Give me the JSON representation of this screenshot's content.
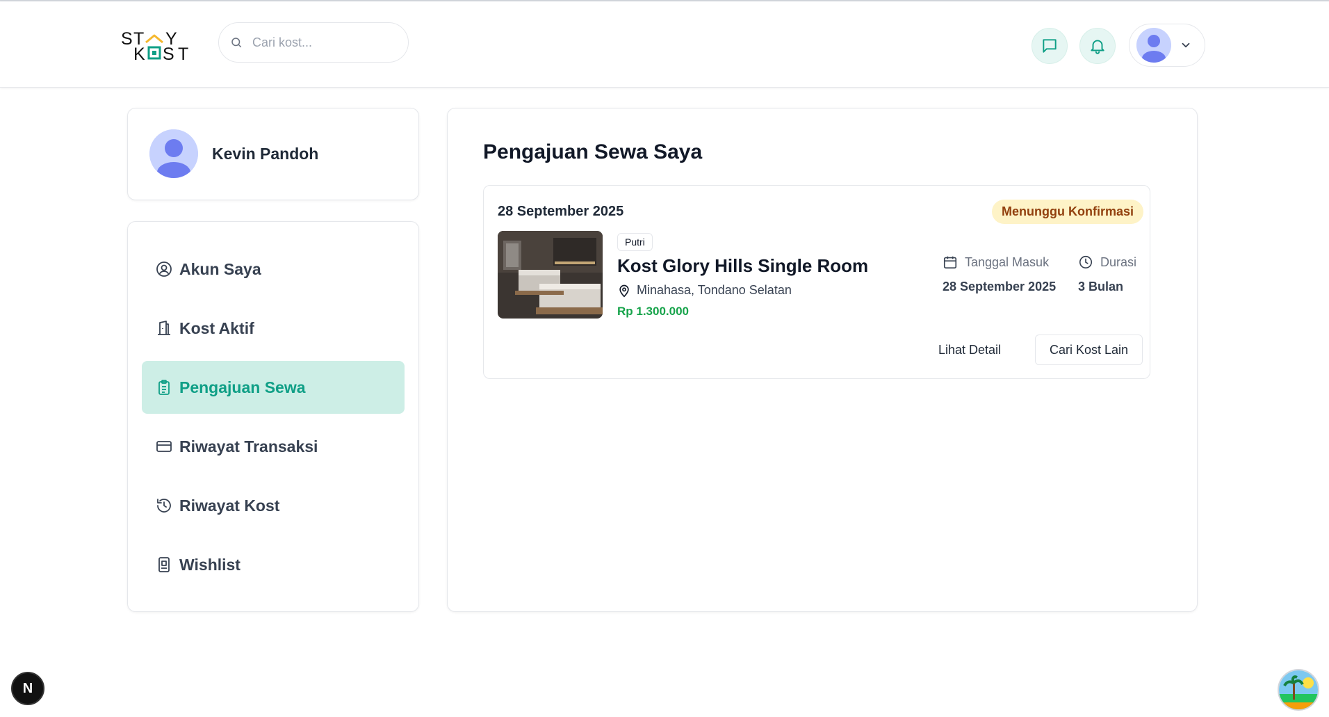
{
  "header": {
    "logo_text": "STAY KOST",
    "search": {
      "placeholder": "Cari kost...",
      "value": ""
    }
  },
  "profile": {
    "name": "Kevin Pandoh"
  },
  "sidebar": {
    "items": [
      {
        "label": "Akun Saya",
        "icon": "user-circle-icon",
        "active": false
      },
      {
        "label": "Kost Aktif",
        "icon": "building-icon",
        "active": false
      },
      {
        "label": "Pengajuan Sewa",
        "icon": "clipboard-list-icon",
        "active": true
      },
      {
        "label": "Riwayat Transaksi",
        "icon": "credit-card-icon",
        "active": false
      },
      {
        "label": "Riwayat Kost",
        "icon": "history-icon",
        "active": false
      },
      {
        "label": "Wishlist",
        "icon": "bookmark-icon",
        "active": false
      }
    ]
  },
  "main": {
    "title": "Pengajuan Sewa Saya",
    "rental": {
      "date": "28 September 2025",
      "status": "Menunggu Konfirmasi",
      "type": "Putri",
      "name": "Kost Glory Hills Single Room",
      "location": "Minahasa, Tondano Selatan",
      "price": "Rp 1.300.000",
      "check_in_label": "Tanggal Masuk",
      "check_in_value": "28 September 2025",
      "duration_label": "Durasi",
      "duration_value": "3 Bulan",
      "detail_button": "Lihat Detail",
      "search_other_button": "Cari Kost Lain"
    }
  },
  "floating": {
    "next_badge": "N"
  },
  "colors": {
    "accent": "#0f9f86",
    "accent_bg": "#cdeee6",
    "price": "#16a34a",
    "status_bg": "#fef3c7",
    "status_text": "#92400e"
  }
}
